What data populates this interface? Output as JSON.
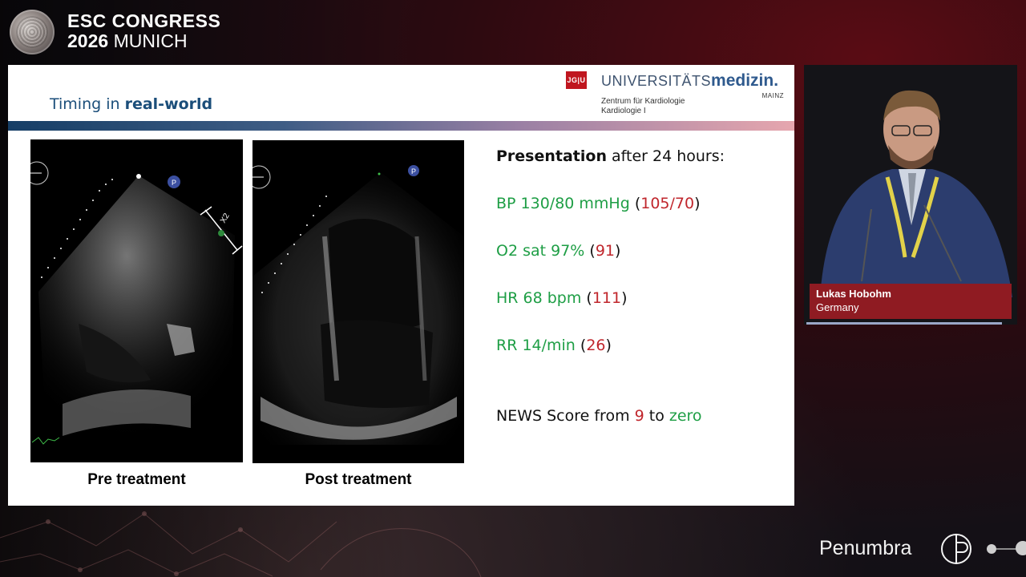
{
  "conference": {
    "line1": "ESC CONGRESS",
    "line2_year": "2026",
    "line2_city": "MUNICH"
  },
  "slide": {
    "title_plain": "Timing in ",
    "title_bold": "real-world",
    "logo": {
      "jgu": "JG|U",
      "name_plain": "UNIVERSITÄTS",
      "name_bold": "medizin.",
      "city": "MAINZ",
      "sub1": "Zentrum für Kardiologie",
      "sub2": "Kardiologie I"
    },
    "images": {
      "pre_caption": "Pre treatment",
      "post_caption": "Post treatment",
      "pre_marker": "P",
      "post_marker": "P",
      "pre_scale": "X2"
    },
    "presentation": {
      "bold": "Presentation",
      "rest": " after 24 hours:"
    },
    "vitals": [
      {
        "value": "BP 130/80 mmHg",
        "open": " (",
        "prior": "105/70",
        "close": ")"
      },
      {
        "value": "O2 sat 97%",
        "open": " (",
        "prior": "91",
        "close": ")"
      },
      {
        "value": "HR 68 bpm",
        "open": " (",
        "prior": "111",
        "close": ")"
      },
      {
        "value": "RR 14/min",
        "open": " (",
        "prior": "26",
        "close": ")"
      }
    ],
    "news": {
      "prefix": "NEWS Score from ",
      "from": "9",
      "mid": " to ",
      "to": "zero"
    }
  },
  "speaker": {
    "name": "Lukas Hobohm",
    "country": "Germany"
  },
  "sponsor": {
    "name": "Penumbra"
  },
  "colors": {
    "title_blue": "#1b4e7a",
    "vital_green": "#1e9e45",
    "prior_red": "#c0262c",
    "nameplate_red": "#8f1b22"
  }
}
